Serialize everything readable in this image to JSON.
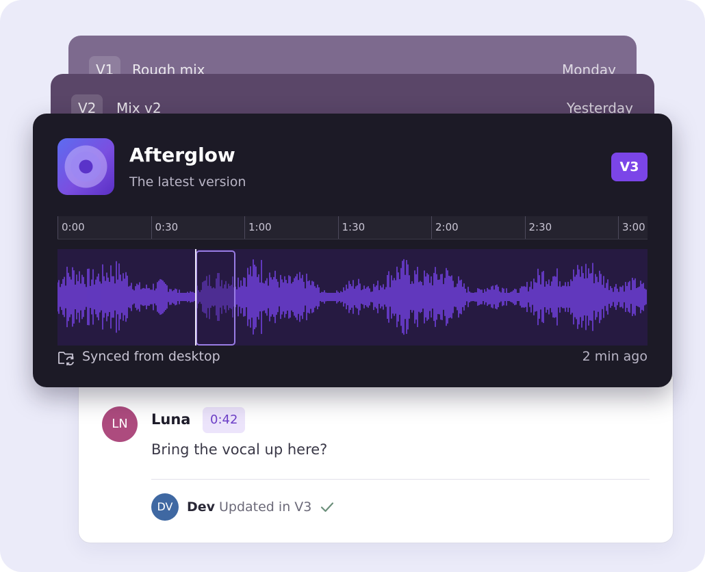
{
  "versions": [
    {
      "tag": "V1",
      "name": "Rough mix",
      "date": "Monday"
    },
    {
      "tag": "V2",
      "name": "Mix v2",
      "date": "Yesterday"
    }
  ],
  "current": {
    "title": "Afterglow",
    "subtitle": "The latest version",
    "tag": "V3",
    "cover_icon": "disc-icon",
    "timeline": [
      "0:00",
      "0:30",
      "1:00",
      "1:30",
      "2:00",
      "2:30",
      "3:00"
    ],
    "selection_range_seconds": [
      40,
      50
    ],
    "playhead_seconds": 40,
    "sync_icon": "folder-sync-icon",
    "sync_text": "Synced from desktop",
    "sync_time": "2 min ago"
  },
  "comment": {
    "avatar_initials": "LN",
    "author": "Luna",
    "timestamp": "0:42",
    "text": "Bring the vocal up here?",
    "reply": {
      "avatar_initials": "DV",
      "author": "Dev",
      "text": "Updated in V3",
      "icon": "check-icon"
    }
  },
  "colors": {
    "accent": "#7b45e8",
    "waveform": "#7b45f2",
    "card_dark": "#1c1a26",
    "luna_avatar": "#ad4b7e",
    "dev_avatar": "#3f68a2"
  }
}
